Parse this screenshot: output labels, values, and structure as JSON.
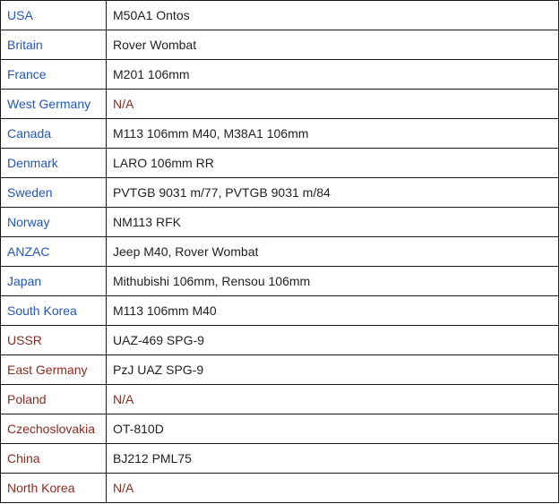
{
  "colors": {
    "nato_link": "#2156b8",
    "pact_link": "#8a2c22",
    "text": "#222222",
    "border": "#1a1a1a"
  },
  "rows": [
    {
      "country": "USA",
      "vehicle": "M50A1 Ontos",
      "bloc": "nato"
    },
    {
      "country": "Britain",
      "vehicle": "Rover Wombat",
      "bloc": "nato"
    },
    {
      "country": "France",
      "vehicle": "M201 106mm",
      "bloc": "nato"
    },
    {
      "country": "West Germany",
      "vehicle": "N/A",
      "bloc": "nato"
    },
    {
      "country": "Canada",
      "vehicle": "M113 106mm M40, M38A1 106mm",
      "bloc": "nato"
    },
    {
      "country": "Denmark",
      "vehicle": "LARO 106mm RR",
      "bloc": "nato"
    },
    {
      "country": "Sweden",
      "vehicle": "PVTGB 9031 m/77, PVTGB 9031 m/84",
      "bloc": "nato"
    },
    {
      "country": "Norway",
      "vehicle": "NM113 RFK",
      "bloc": "nato"
    },
    {
      "country": "ANZAC",
      "vehicle": "Jeep M40, Rover Wombat",
      "bloc": "nato"
    },
    {
      "country": "Japan",
      "vehicle": "Mithubishi 106mm, Rensou 106mm",
      "bloc": "nato"
    },
    {
      "country": "South Korea",
      "vehicle": "M113 106mm M40",
      "bloc": "nato"
    },
    {
      "country": "USSR",
      "vehicle": "UAZ-469 SPG-9",
      "bloc": "pact"
    },
    {
      "country": "East Germany",
      "vehicle": "PzJ UAZ SPG-9",
      "bloc": "pact"
    },
    {
      "country": "Poland",
      "vehicle": "N/A",
      "bloc": "pact"
    },
    {
      "country": "Czechoslovakia",
      "vehicle": "OT-810D",
      "bloc": "pact"
    },
    {
      "country": "China",
      "vehicle": "BJ212 PML75",
      "bloc": "pact"
    },
    {
      "country": "North Korea",
      "vehicle": "N/A",
      "bloc": "pact"
    }
  ]
}
